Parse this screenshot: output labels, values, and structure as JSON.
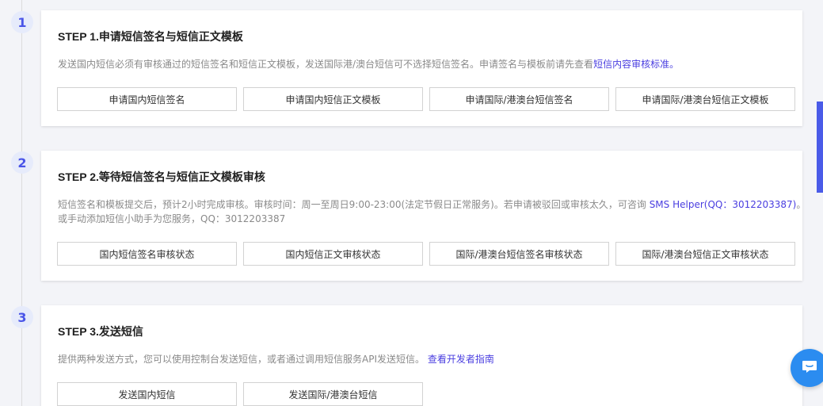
{
  "steps": [
    {
      "num": "1",
      "title": "STEP 1.申请短信签名与短信正文模板",
      "desc": "发送国内短信必须有审核通过的短信签名和短信正文模板，发送国际港/澳台短信可不选择短信签名。申请签名与模板前请先查看",
      "desc_link": "短信内容审核标准。",
      "buttons": [
        "申请国内短信签名",
        "申请国内短信正文模板",
        "申请国际/港澳台短信签名",
        "申请国际/港澳台短信正文模板"
      ]
    },
    {
      "num": "2",
      "title": "STEP 2.等待短信签名与短信正文模板审核",
      "desc": "短信签名和模板提交后，预计2小时完成审核。审核时间：周一至周日9:00-23:00(法定节假日正常服务)。若申请被驳回或审核太久，可咨询 ",
      "desc_link": "SMS Helper(QQ：3012203387)",
      "desc_suffix": "。",
      "desc_line2": "或手动添加短信小助手为您服务，QQ：3012203387",
      "buttons": [
        "国内短信签名审核状态",
        "国内短信正文审核状态",
        "国际/港澳台短信签名审核状态",
        "国际/港澳台短信正文审核状态"
      ]
    },
    {
      "num": "3",
      "title": "STEP 3.发送短信",
      "desc": "提供两种发送方式，您可以使用控制台发送短信，或者通过调用短信服务API发送短信。",
      "desc_link": "查看开发者指南",
      "buttons": [
        "发送国内短信",
        "发送国际/港澳台短信"
      ]
    }
  ],
  "colors": {
    "accent": "#4a55e8",
    "link": "#4a3ee0",
    "chat": "#2b8cf0"
  },
  "chat_icon": "chat-bubble-icon"
}
